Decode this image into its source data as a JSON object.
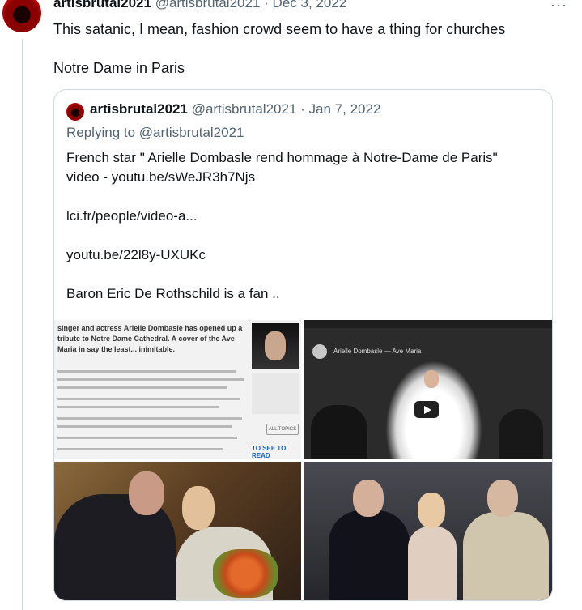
{
  "tweet": {
    "author_name": "artisbrutal2021",
    "author_handle": "@artisbrutal2021",
    "separator": "·",
    "date": "Dec 3, 2022",
    "more_label": "···",
    "text_line1": "This satanic, I mean, fashion crowd seem to have a thing for churches",
    "text_line2": "Notre Dame in Paris"
  },
  "quote": {
    "author_name": "artisbrutal2021",
    "author_handle": "@artisbrutal2021",
    "separator": "·",
    "date": "Jan 7, 2022",
    "replying_to": "Replying to @artisbrutal2021",
    "body_line1": "French star \" Arielle Dombasle rend hommage à Notre-Dame de Paris\"",
    "body_line2": "video -  youtu.be/sWeJR3h7Njs",
    "body_line3": "lci.fr/people/video-a...",
    "body_line4": "youtu.be/22l8y-UXUKc",
    "body_line5": "Baron Eric De Rothschild  is a fan .."
  },
  "media": {
    "article_headline": "singer and actress Arielle Dombasle has opened up a tribute to Notre Dame Cathedral. A cover of the Ave Maria in say the least... inimitable.",
    "article_button": "ALL TOPICS",
    "article_cta": "TO SEE TO READ",
    "video_title": "Arielle Dombasle — Ave Maria"
  },
  "colors": {
    "text_primary": "#0f1419",
    "text_secondary": "#536471",
    "border": "#cfd9de"
  }
}
